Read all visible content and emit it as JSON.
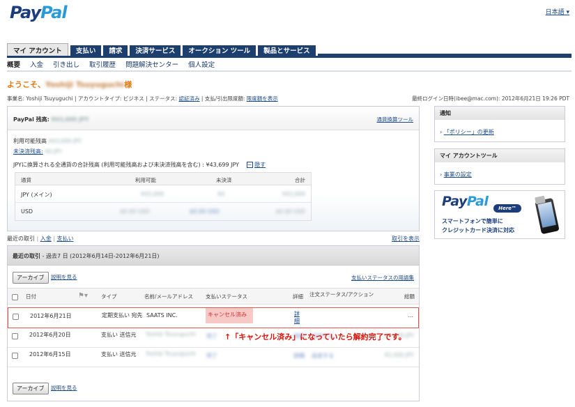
{
  "header": {
    "logo_part1": "Pay",
    "logo_part2": "Pal",
    "language": "日本語",
    "language_caret": "▾"
  },
  "tabs": [
    "マイ アカウント",
    "支払い",
    "請求",
    "決済サービス",
    "オークション ツール",
    "製品とサービス"
  ],
  "subnav": [
    "概要",
    "入金",
    "引き出し",
    "取引履歴",
    "問題解決センター",
    "個人設定"
  ],
  "welcome": {
    "prefix": "ようこそ、",
    "name": "Yoshiji Tsuyuguchi",
    "suffix": "様"
  },
  "account_info": {
    "business_name_label": "事業名:",
    "business_name": "Yoshiji Tsuyuguchi",
    "account_type": "アカウントタイプ: ビジネス",
    "status_label": "ステータス:",
    "status": "認証済み",
    "limit_label": "支払/引出限度額:",
    "limit_link": "限度額を表示",
    "last_login": "最終ログイン日時(ibee@mac.com): 2012年6月21日 19:26 PDT"
  },
  "balance": {
    "title": "PayPal 残高:",
    "title_value": "¥43,699 JPY",
    "currency_tool": "通貨換算ツール",
    "available_label": "利用可能残高",
    "available_value": "¥43,699 JPY",
    "pending_label": "未決済残高:",
    "pending_value": "¥0 JPY",
    "total_text": "JPYに換算される全通貨の合計残高 (利用可能残高および未決済残高を含む) : ¥43,699 JPY",
    "collapse_icon": "−",
    "collapse_label": "隠す",
    "columns": [
      "通貨",
      "利用可能",
      "未決済",
      "合計"
    ],
    "rows": [
      {
        "currency": "JPY (メイン)",
        "available": "¥43,699",
        "pending": "¥0",
        "total": "¥43,699"
      },
      {
        "currency": "USD",
        "available": "$0.00 USD",
        "pending": "$0.00 USD",
        "total": "$0.00 USD"
      }
    ]
  },
  "notice": {
    "title": "通知",
    "link": "「ポリシー」の更新"
  },
  "tools": {
    "title": "マイ アカウントツール",
    "link": "事業の設定"
  },
  "ad": {
    "logo1": "Pay",
    "logo2": "Pal",
    "here": "Here",
    "tm": "™",
    "line1": "スマートフォンで簡単に",
    "line2": "クレジットカード決済に対応"
  },
  "recent_nav": {
    "label": "最近の取引",
    "sep": "|",
    "in": "入金",
    "out": "支払い",
    "view_all": "取引を表示"
  },
  "transactions": {
    "title": "最近の取引",
    "period": " - 過去7 日 (2012年6月14日-2012年6月21日)",
    "archive": "アーカイブ",
    "help": "説明を見る",
    "glossary": "支払いステータスの用語集",
    "columns": [
      "日付",
      "タイプ",
      "名前/メールアドレス",
      "支払いステータス",
      "詳細",
      "注文ステータス/アクション",
      "総額"
    ],
    "rows": [
      {
        "date": "2012年6月21日",
        "type": "定期支払い 宛先",
        "name": "SAATS INC.",
        "status": "キャンセル済み",
        "detail": "詳細",
        "order": "",
        "amount": "..."
      },
      {
        "date": "2012年6月20日",
        "type": "支払い 送信元",
        "name": "Yoshiji Tsuyuguchi",
        "status": "完了",
        "detail": "詳細",
        "order": "返金する",
        "amount": "¥1,000 JPY"
      },
      {
        "date": "2012年6月15日",
        "type": "支払い 送信元",
        "name": "Yoshiji Tsuyuguchi",
        "status": "完了",
        "detail": "詳細",
        "order": "返金する",
        "amount": "¥2,500 JPY"
      }
    ]
  },
  "annotation": "↑「キャンセル済み」になっていたら解約完了です。"
}
